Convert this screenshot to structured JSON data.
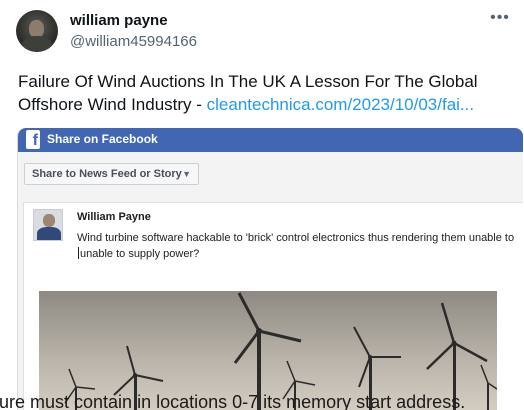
{
  "tweet": {
    "display_name": "william payne",
    "handle": "@william45994166",
    "more_icon": "more-horizontal-icon",
    "text_line1": "Failure Of Wind Auctions In The UK A Lesson For The Global",
    "text_line2_prefix": "Offshore Wind Industry - ",
    "link_text": "cleantechnica.com/2023/10/03/fai..."
  },
  "embed": {
    "fb_header": "Share on Facebook",
    "share_target": "Share to News Feed or Story",
    "post": {
      "author": "William Payne",
      "text_part1": "Wind turbine software hackable to 'brick' control electronics thus rendering them unable to ",
      "text_part2": "unable to supply power?"
    },
    "image_subject": "wind turbines silhouetted against hazy sky"
  },
  "background_text": "ure must contain in locations 0-7 its memory start address.",
  "colors": {
    "facebook_blue": "#4267b2",
    "link_blue": "#1d9bf0",
    "secondary_text": "#536471"
  }
}
